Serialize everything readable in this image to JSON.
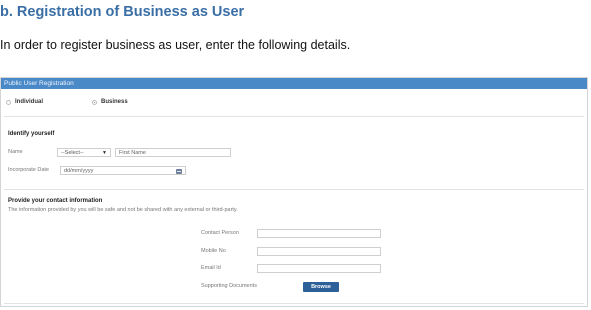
{
  "doc": {
    "heading": "b.   Registration of Business as User",
    "intro": "In order to register business as user, enter the following details."
  },
  "form": {
    "header": "Public User Registration",
    "radio": {
      "individual": "Individual",
      "business": "Business",
      "selected": "Business"
    },
    "identify": {
      "title": "Identify yourself",
      "name_label": "Name",
      "select_value": "--Select--",
      "first_name_placeholder": "First Name",
      "incorporate_label": "Incorporate Date",
      "date_placeholder": "dd/mm/yyyy"
    },
    "contact": {
      "title": "Provide your contact information",
      "note": "The information provided by you will be safe and not be shared with any external or third-party.",
      "contact_person_label": "Contact Person",
      "mobile_label": "Mobile No",
      "email_label": "Email Id",
      "documents_label": "Supporting Documents",
      "browse_label": "Browse"
    }
  },
  "colors": {
    "heading": "#3a6ea5",
    "header_bar": "#4a89c8",
    "button": "#2d5f99"
  }
}
